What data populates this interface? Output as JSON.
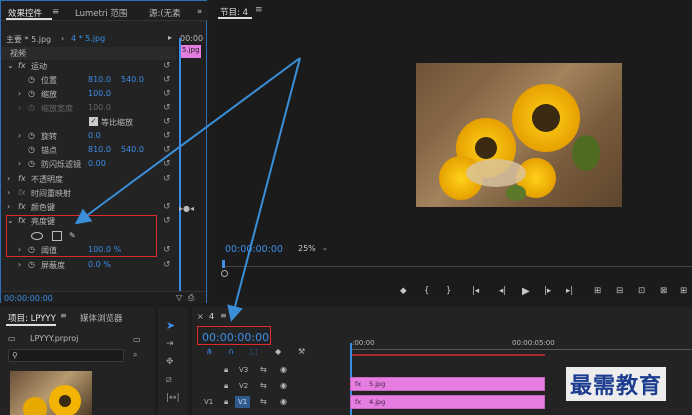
{
  "effects_panel": {
    "tabs": [
      "效果控件",
      "Lumetri 范围",
      "源:(无素"
    ],
    "master_label": "主要 * 5.jpg",
    "clip_label": "4 * 5.jpg",
    "ruler_time": "00:00",
    "clip_chip": "5.jpg",
    "video_header": "视频",
    "motion": "运动",
    "position": "位置",
    "pos_x": "810.0",
    "pos_y": "540.0",
    "scale": "缩放",
    "scale_val": "100.0",
    "scale_width": "缩放宽度",
    "scale_width_val": "100.0",
    "uniform_scale": "等比缩放",
    "rotation": "旋转",
    "rotation_val": "0.0",
    "anchor": "锚点",
    "anchor_x": "810.0",
    "anchor_y": "540.0",
    "flicker": "防闪烁滤镜",
    "flicker_val": "0.00",
    "opacity": "不透明度",
    "remap": "时间重映射",
    "color_key": "颜色键",
    "luma_key": "亮度键",
    "threshold": "阈值",
    "threshold_val": "100.0 %",
    "cutoff": "屏蔽度",
    "cutoff_val": "0.0 %",
    "footer_time": "00:00:00:00"
  },
  "program": {
    "title": "节目: 4",
    "timecode": "00:00:00:00",
    "zoom": "25%"
  },
  "project": {
    "tabs": [
      "项目: LPYYY",
      "媒体浏览器"
    ],
    "file": "LPYYY.prproj"
  },
  "timeline": {
    "tab": "4",
    "timecode": "00:00:00:00",
    "ruler_start": ":00:00",
    "ruler_mid": "00:00:05:00",
    "tracks": [
      "V3",
      "V2",
      "V1"
    ],
    "src": "V1",
    "clip_v2": "5.jpg",
    "clip_v1": "4.jpg"
  },
  "watermark": "最需教育",
  "colors": {
    "accent": "#3b8ee8",
    "highlight": "#e0282e",
    "clip": "#e57ee0",
    "arrow": "#3a8fd8"
  }
}
